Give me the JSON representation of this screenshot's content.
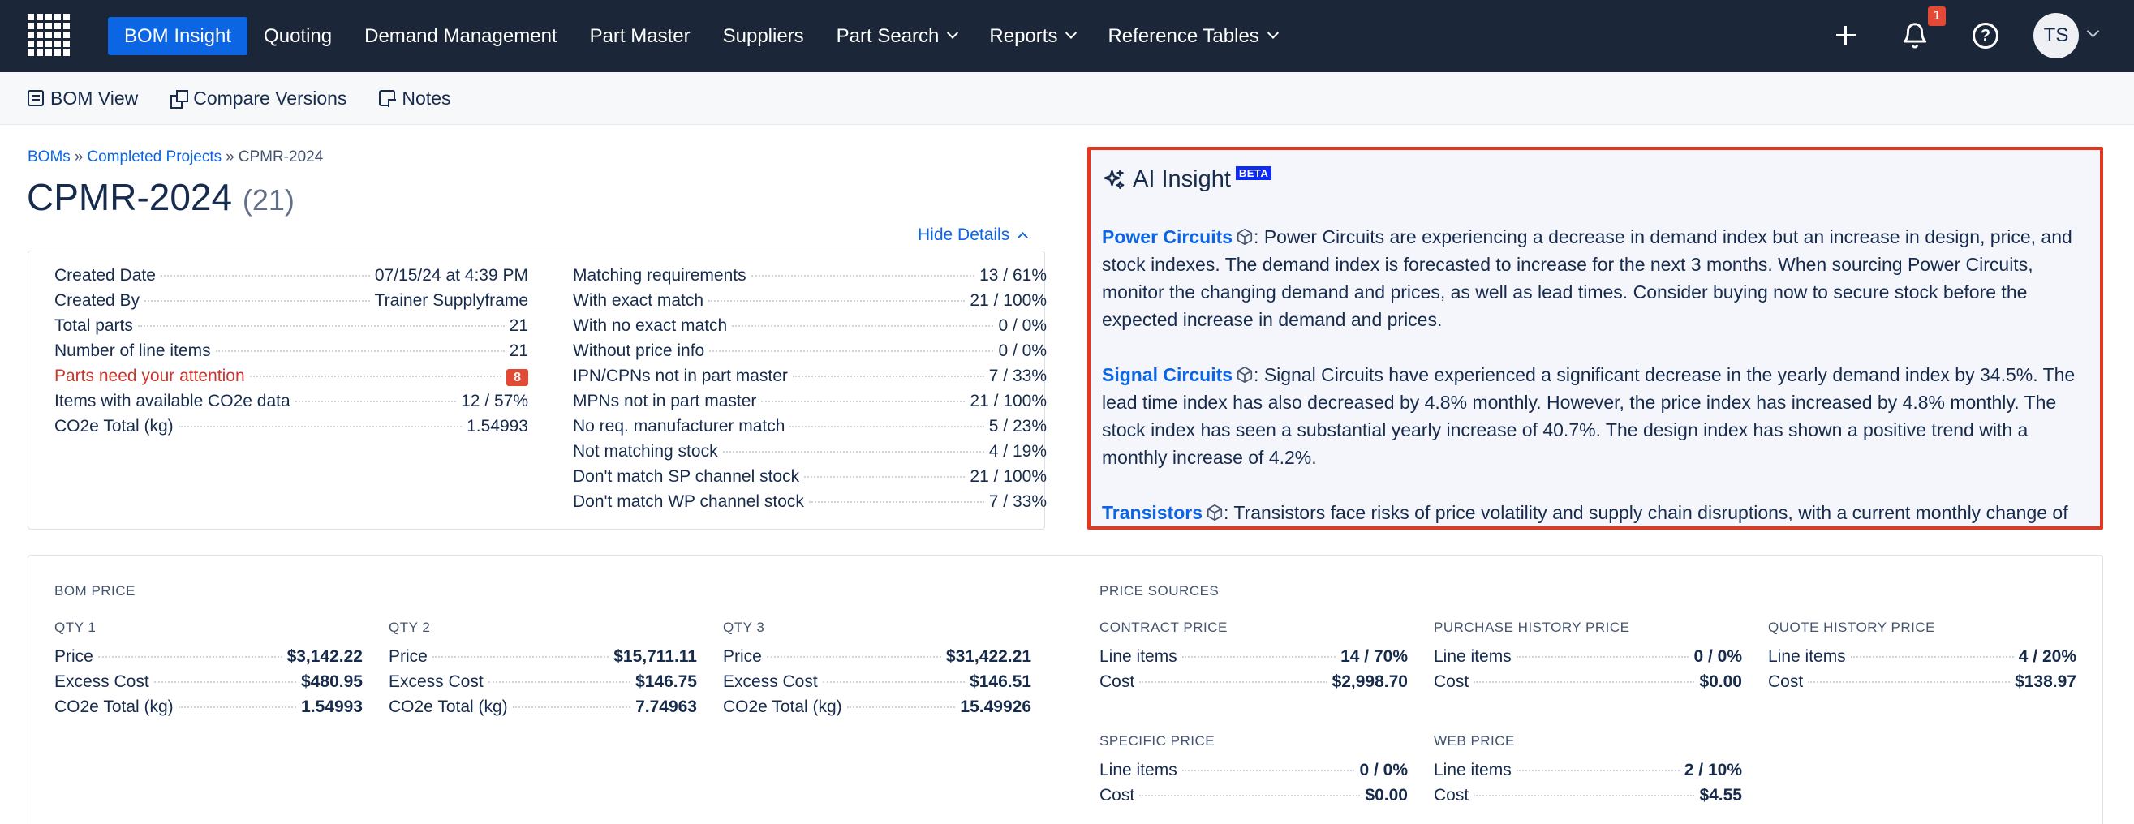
{
  "nav": {
    "items": [
      {
        "label": "BOM Insight",
        "active": true,
        "dropdown": false
      },
      {
        "label": "Quoting",
        "active": false,
        "dropdown": false
      },
      {
        "label": "Demand Management",
        "active": false,
        "dropdown": false
      },
      {
        "label": "Part Master",
        "active": false,
        "dropdown": false
      },
      {
        "label": "Suppliers",
        "active": false,
        "dropdown": false
      },
      {
        "label": "Part Search",
        "active": false,
        "dropdown": true
      },
      {
        "label": "Reports",
        "active": false,
        "dropdown": true
      },
      {
        "label": "Reference Tables",
        "active": false,
        "dropdown": true
      }
    ],
    "notification_count": "1",
    "avatar_initials": "TS",
    "icons": [
      "grid-logo-icon",
      "plus-icon",
      "bell-icon",
      "help-icon",
      "chevron-down-icon"
    ]
  },
  "toolbar": {
    "bom_view": "BOM View",
    "compare_versions": "Compare Versions",
    "notes": "Notes"
  },
  "breadcrumb": {
    "boms": "BOMs",
    "completed": "Completed Projects",
    "current": "CPMR-2024",
    "separator": "»"
  },
  "page": {
    "title": "CPMR-2024",
    "count": "(21)",
    "hide_details": "Hide Details"
  },
  "details": {
    "left": [
      {
        "label": "Created Date",
        "value": "07/15/24 at 4:39 PM"
      },
      {
        "label": "Created By",
        "value": "Trainer Supplyframe"
      },
      {
        "label": "Total parts",
        "value": "21"
      },
      {
        "label": "Number of line items",
        "value": "21"
      },
      {
        "label": "Parts need your attention",
        "value": "8",
        "attention": true
      },
      {
        "label": "Items with available CO2e data",
        "value": "12 / 57%"
      },
      {
        "label": "CO2e Total (kg)",
        "value": "1.54993"
      }
    ],
    "right": [
      {
        "label": "Matching requirements",
        "value": "13 / 61%"
      },
      {
        "label": "With exact match",
        "value": "21 / 100%"
      },
      {
        "label": "With no exact match",
        "value": "0 / 0%"
      },
      {
        "label": "Without price info",
        "value": "0 / 0%"
      },
      {
        "label": "IPN/CPNs not in part master",
        "value": "7 / 33%"
      },
      {
        "label": "MPNs not in part master",
        "value": "21 / 100%"
      },
      {
        "label": "No req. manufacturer match",
        "value": "5 / 23%"
      },
      {
        "label": "Not matching stock",
        "value": "4 / 19%"
      },
      {
        "label": "Don't match SP channel stock",
        "value": "21 / 100%"
      },
      {
        "label": "Don't match WP channel stock",
        "value": "7 / 33%"
      }
    ]
  },
  "ai_insight": {
    "title": "AI Insight",
    "badge": "BETA",
    "items": [
      {
        "topic": "Power Circuits",
        "text": ": Power Circuits are experiencing a decrease in demand index but an increase in design, price, and stock indexes. The demand index is forecasted to increase for the next 3 months. When sourcing Power Circuits, monitor the changing demand and prices, as well as lead times. Consider buying now to secure stock before the expected increase in demand and prices."
      },
      {
        "topic": "Signal Circuits",
        "text": ": Signal Circuits have experienced a significant decrease in the yearly demand index by 34.5%. The lead time index has also decreased by 4.8% monthly. However, the price index has increased by 4.8% monthly. The stock index has seen a substantial yearly increase of 40.7%. The design index has shown a positive trend with a monthly increase of 4.2%."
      },
      {
        "topic": "Transistors",
        "text": ": Transistors face risks of price volatility and supply chain disruptions, with a current monthly change of"
      }
    ]
  },
  "bom_price": {
    "label": "BOM PRICE",
    "qtys": [
      {
        "label": "QTY 1",
        "rows": [
          {
            "label": "Price",
            "value": "$3,142.22"
          },
          {
            "label": "Excess Cost",
            "value": "$480.95"
          },
          {
            "label": "CO2e Total (kg)",
            "value": "1.54993"
          }
        ]
      },
      {
        "label": "QTY 2",
        "rows": [
          {
            "label": "Price",
            "value": "$15,711.11"
          },
          {
            "label": "Excess Cost",
            "value": "$146.75"
          },
          {
            "label": "CO2e Total (kg)",
            "value": "7.74963"
          }
        ]
      },
      {
        "label": "QTY 3",
        "rows": [
          {
            "label": "Price",
            "value": "$31,422.21"
          },
          {
            "label": "Excess Cost",
            "value": "$146.51"
          },
          {
            "label": "CO2e Total (kg)",
            "value": "15.49926"
          }
        ]
      }
    ]
  },
  "price_sources": {
    "label": "PRICE SOURCES",
    "groups": [
      {
        "label": "CONTRACT PRICE",
        "rows": [
          {
            "label": "Line items",
            "value": "14 / 70%"
          },
          {
            "label": "Cost",
            "value": "$2,998.70"
          }
        ]
      },
      {
        "label": "PURCHASE HISTORY PRICE",
        "rows": [
          {
            "label": "Line items",
            "value": "0 / 0%"
          },
          {
            "label": "Cost",
            "value": "$0.00"
          }
        ]
      },
      {
        "label": "QUOTE HISTORY PRICE",
        "rows": [
          {
            "label": "Line items",
            "value": "4 / 20%"
          },
          {
            "label": "Cost",
            "value": "$138.97"
          }
        ]
      },
      {
        "label": "SPECIFIC PRICE",
        "rows": [
          {
            "label": "Line items",
            "value": "0 / 0%"
          },
          {
            "label": "Cost",
            "value": "$0.00"
          }
        ]
      },
      {
        "label": "WEB PRICE",
        "rows": [
          {
            "label": "Line items",
            "value": "2 / 10%"
          },
          {
            "label": "Cost",
            "value": "$4.55"
          }
        ]
      }
    ]
  },
  "colors": {
    "nav_bg": "#1b2638",
    "active_tab": "#0c66e4",
    "link": "#0c66e4",
    "attention": "#c9372c",
    "highlight_border": "#e5361e"
  }
}
